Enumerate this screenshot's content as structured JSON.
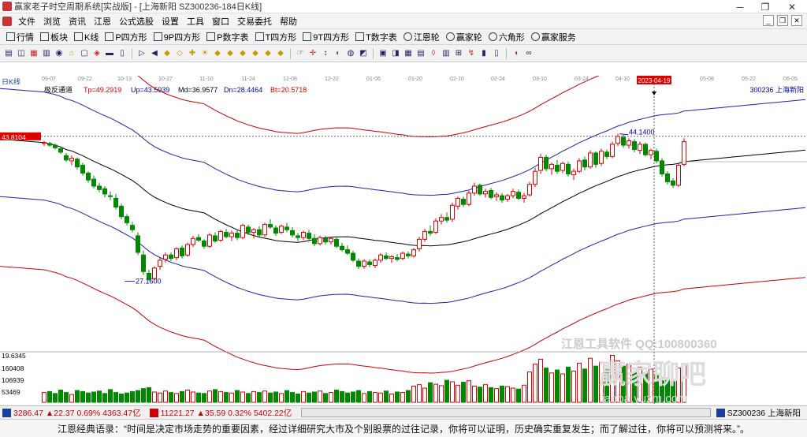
{
  "window": {
    "title": "赢家老子时空周期系统[实战版] - [上海新阳  SZ300236-184日K线]",
    "min": "─",
    "max": "❐",
    "close": "✕"
  },
  "menu": [
    "文件",
    "浏览",
    "资讯",
    "江恩",
    "公式选股",
    "设置",
    "工具",
    "窗口",
    "交易委托",
    "帮助"
  ],
  "toolbar1": [
    {
      "label": "行情",
      "icon": "grid-icon"
    },
    {
      "label": "板块",
      "icon": "blocks-icon"
    },
    {
      "label": "K线",
      "icon": "candle-icon"
    },
    {
      "label": "P四方形",
      "icon": "p-square-icon"
    },
    {
      "label": "9P四方形",
      "icon": "9p-square-icon"
    },
    {
      "label": "P数字表",
      "icon": "p-table-icon"
    },
    {
      "label": "T四方形",
      "icon": "t-square-icon"
    },
    {
      "label": "9T四方形",
      "icon": "9t-square-icon"
    },
    {
      "label": "T数字表",
      "icon": "t-table-icon"
    },
    {
      "label": "江恩轮",
      "icon": "gann-wheel-icon"
    },
    {
      "label": "赢家轮",
      "icon": "winner-wheel-icon"
    },
    {
      "label": "六角形",
      "icon": "hexagon-icon"
    },
    {
      "label": "赢家服务",
      "icon": "service-icon"
    }
  ],
  "toolbar2": [
    "▤",
    "◫",
    "▦",
    "▥",
    "◉",
    "⌂",
    "▢",
    "◈",
    "▬",
    "▯",
    "▷",
    "◀",
    "◆",
    "◇",
    "✚",
    "☀",
    "◆",
    "◆",
    "◆",
    "◆",
    "◆",
    "◆",
    "☞",
    "✛",
    "↕",
    "◐",
    "◍",
    "◩",
    "▣",
    "◨",
    "▦",
    "▤",
    "◊",
    "▥",
    "⊞",
    "↯",
    "▮",
    "▯",
    "◖",
    "∞"
  ],
  "dates": [
    "09-07",
    "09-22",
    "10-13",
    "10-27",
    "11-10",
    "11-24",
    "12-08",
    "12-22",
    "01-06",
    "01-20",
    "02-10",
    "02-24",
    "03-10",
    "03-24",
    "04-10",
    "2023-04-19",
    "05-08",
    "05-22",
    "06-05"
  ],
  "period": "日K线",
  "indicator": {
    "name": "极反通道",
    "tp": "Tp=49.2919",
    "up": "Up=43.5939",
    "md": "Md=36.9577",
    "dn": "Dn=28.4464",
    "bt": "Bt=20.5718"
  },
  "stock_tag": "300236 上海新阳",
  "price_marker": "43.8104",
  "annotations": {
    "high": "44.1400",
    "low": "27.1600"
  },
  "volume": {
    "max_label": "19.6345",
    "ticks": [
      "160408",
      "106939",
      "53469"
    ]
  },
  "watermark": {
    "line1": "江恩工具软件  QQ:100800360",
    "line2": "赢家聊吧",
    "line3": "liaoba.yuzm.com"
  },
  "status": [
    {
      "icon": "sh-index-icon",
      "text": "3286.47 ▲22.37 0.69% 4363.47亿",
      "color": "#c00"
    },
    {
      "icon": "sz-index-icon",
      "text": "11221.27 ▲35.59 0.32% 5402.22亿",
      "color": "#c00"
    },
    {
      "icon": "stock-icon",
      "text": "SZ300236 上海新阳",
      "color": "#000"
    }
  ],
  "quote": "江恩经典语录：“时间是决定市场走势的重要因素，经过详细研究大市及个别股票的过往记录，你将可以证明，历史确实重复发生；而了解过往，你将可以预测将来。”。",
  "chart_data": {
    "type": "candlestick",
    "title": "SZ300236 上海新阳 日K线",
    "ylim": [
      19.6345,
      49.5
    ],
    "candles": [
      [
        43.0,
        43.3,
        42.7,
        43.1
      ],
      [
        43.0,
        43.2,
        42.6,
        42.8
      ],
      [
        42.8,
        43.0,
        42.3,
        42.5
      ],
      [
        42.4,
        42.6,
        41.8,
        42.0
      ],
      [
        41.6,
        41.9,
        40.9,
        41.1
      ],
      [
        41.0,
        41.6,
        40.5,
        41.3
      ],
      [
        41.2,
        41.4,
        40.0,
        40.3
      ],
      [
        40.5,
        40.8,
        39.3,
        39.6
      ],
      [
        39.6,
        39.8,
        38.5,
        38.8
      ],
      [
        38.9,
        39.3,
        37.8,
        38.1
      ],
      [
        38.1,
        38.5,
        37.4,
        37.7
      ],
      [
        37.8,
        38.1,
        36.8,
        37.2
      ],
      [
        37.0,
        37.5,
        36.5,
        36.9
      ],
      [
        36.7,
        37.2,
        35.4,
        35.7
      ],
      [
        35.8,
        36.1,
        34.3,
        34.6
      ],
      [
        34.6,
        34.9,
        33.6,
        33.9
      ],
      [
        33.6,
        34.0,
        32.8,
        33.1
      ],
      [
        32.4,
        32.8,
        30.2,
        30.5
      ],
      [
        30.2,
        30.7,
        27.9,
        28.3
      ],
      [
        28.1,
        28.5,
        27.2,
        27.4
      ],
      [
        27.5,
        28.9,
        27.3,
        28.7
      ],
      [
        28.9,
        29.9,
        28.5,
        29.6
      ],
      [
        29.7,
        30.5,
        29.3,
        30.2
      ],
      [
        30.2,
        30.5,
        29.5,
        29.8
      ],
      [
        29.9,
        31.1,
        29.6,
        30.9
      ],
      [
        31.0,
        31.3,
        29.8,
        30.1
      ],
      [
        30.2,
        31.6,
        30.0,
        31.4
      ],
      [
        31.4,
        32.4,
        31.1,
        32.1
      ],
      [
        32.2,
        32.6,
        31.7,
        31.9
      ],
      [
        31.8,
        32.0,
        30.9,
        31.2
      ],
      [
        31.2,
        32.7,
        31.0,
        32.5
      ],
      [
        32.4,
        32.8,
        31.6,
        31.8
      ],
      [
        31.9,
        33.1,
        31.7,
        32.9
      ],
      [
        32.8,
        33.2,
        32.1,
        32.3
      ],
      [
        32.3,
        33.0,
        31.8,
        32.7
      ],
      [
        32.7,
        33.0,
        31.9,
        32.2
      ],
      [
        32.2,
        33.8,
        32.0,
        33.6
      ],
      [
        33.4,
        33.7,
        32.5,
        32.8
      ],
      [
        32.8,
        33.3,
        32.1,
        33.1
      ],
      [
        33.1,
        33.5,
        32.3,
        32.5
      ],
      [
        32.5,
        33.9,
        32.3,
        33.7
      ],
      [
        33.7,
        34.3,
        33.2,
        33.4
      ],
      [
        33.3,
        33.6,
        32.4,
        32.7
      ],
      [
        32.8,
        33.7,
        32.6,
        33.5
      ],
      [
        33.4,
        33.9,
        32.8,
        33.1
      ],
      [
        33.0,
        33.4,
        32.2,
        32.5
      ],
      [
        32.4,
        32.7,
        31.8,
        32.2
      ],
      [
        32.2,
        33.0,
        31.9,
        32.8
      ],
      [
        32.7,
        33.1,
        31.9,
        32.1
      ],
      [
        32.1,
        32.6,
        31.2,
        31.5
      ],
      [
        31.5,
        32.4,
        31.3,
        32.2
      ],
      [
        32.1,
        32.4,
        31.4,
        31.7
      ],
      [
        31.7,
        32.3,
        31.4,
        32.1
      ],
      [
        32.0,
        32.3,
        31.0,
        31.2
      ],
      [
        31.2,
        31.6,
        30.6,
        30.8
      ],
      [
        30.8,
        31.3,
        30.2,
        30.4
      ],
      [
        30.4,
        30.7,
        29.4,
        29.6
      ],
      [
        29.5,
        29.8,
        28.6,
        28.9
      ],
      [
        28.9,
        29.7,
        28.6,
        29.5
      ],
      [
        29.4,
        29.7,
        28.8,
        29.1
      ],
      [
        29.0,
        29.8,
        28.7,
        29.6
      ],
      [
        29.6,
        30.4,
        29.3,
        30.2
      ],
      [
        30.1,
        30.5,
        29.6,
        29.8
      ],
      [
        29.8,
        30.2,
        29.3,
        30.0
      ],
      [
        29.9,
        30.3,
        29.5,
        29.7
      ],
      [
        29.8,
        30.6,
        29.6,
        30.4
      ],
      [
        30.3,
        30.6,
        29.8,
        30.1
      ],
      [
        30.1,
        31.0,
        29.9,
        30.8
      ],
      [
        30.9,
        32.3,
        30.6,
        32.0
      ],
      [
        32.0,
        33.2,
        31.7,
        32.9
      ],
      [
        32.9,
        33.6,
        32.4,
        32.7
      ],
      [
        32.8,
        34.4,
        32.6,
        34.1
      ],
      [
        34.1,
        34.9,
        33.7,
        34.5
      ],
      [
        34.5,
        35.1,
        33.9,
        34.2
      ],
      [
        34.3,
        36.2,
        34.0,
        35.9
      ],
      [
        35.8,
        36.9,
        35.4,
        36.7
      ],
      [
        36.6,
        36.9,
        35.7,
        36.0
      ],
      [
        36.0,
        37.6,
        35.8,
        37.3
      ],
      [
        37.3,
        38.5,
        37.0,
        38.1
      ],
      [
        38.2,
        38.4,
        37.0,
        37.2
      ],
      [
        37.2,
        37.8,
        36.8,
        37.5
      ],
      [
        37.6,
        37.9,
        36.6,
        36.8
      ],
      [
        36.9,
        37.4,
        36.4,
        37.1
      ],
      [
        37.0,
        37.3,
        36.2,
        36.5
      ],
      [
        36.6,
        37.2,
        36.3,
        37.0
      ],
      [
        37.0,
        37.8,
        36.7,
        37.5
      ],
      [
        37.4,
        37.7,
        36.5,
        36.7
      ],
      [
        36.7,
        37.3,
        36.2,
        37.0
      ],
      [
        37.1,
        38.6,
        36.9,
        38.3
      ],
      [
        38.3,
        40.2,
        38.0,
        39.8
      ],
      [
        39.9,
        41.8,
        39.5,
        41.4
      ],
      [
        41.4,
        41.7,
        39.8,
        40.1
      ],
      [
        40.1,
        40.8,
        39.4,
        40.6
      ],
      [
        40.5,
        41.1,
        39.5,
        39.8
      ],
      [
        39.9,
        40.9,
        39.6,
        40.7
      ],
      [
        40.6,
        40.9,
        39.2,
        39.5
      ],
      [
        39.4,
        40.1,
        38.8,
        39.8
      ],
      [
        39.8,
        41.3,
        39.6,
        41.0
      ],
      [
        41.1,
        41.5,
        39.9,
        40.3
      ],
      [
        40.3,
        42.2,
        40.1,
        41.9
      ],
      [
        41.9,
        42.1,
        40.2,
        40.6
      ],
      [
        40.7,
        42.4,
        40.4,
        42.1
      ],
      [
        42.0,
        42.3,
        41.2,
        41.5
      ],
      [
        41.5,
        43.2,
        41.3,
        42.9
      ],
      [
        43.0,
        44.1,
        42.7,
        43.8
      ],
      [
        43.7,
        44.0,
        42.5,
        42.8
      ],
      [
        42.8,
        43.6,
        42.4,
        43.3
      ],
      [
        43.2,
        43.5,
        42.0,
        42.3
      ],
      [
        42.2,
        43.2,
        41.8,
        42.9
      ],
      [
        42.9,
        43.1,
        41.5,
        41.7
      ],
      [
        41.7,
        42.4,
        41.2,
        42.2
      ],
      [
        42.1,
        42.4,
        40.7,
        41.0
      ],
      [
        41.0,
        41.3,
        39.2,
        39.5
      ],
      [
        39.5,
        39.8,
        38.3,
        38.6
      ],
      [
        38.7,
        39.0,
        37.9,
        38.2
      ],
      [
        38.2,
        40.8,
        38.0,
        40.5
      ],
      [
        40.6,
        43.6,
        40.4,
        43.2
      ]
    ],
    "volume": [
      20,
      22,
      18,
      25,
      20,
      16,
      24,
      22,
      19,
      21,
      23,
      18,
      26,
      20,
      17,
      19,
      22,
      24,
      28,
      30,
      21,
      19,
      23,
      20,
      18,
      22,
      25,
      21,
      19,
      18,
      23,
      26,
      22,
      20,
      19,
      24,
      21,
      18,
      22,
      20,
      23,
      19,
      21,
      18,
      24,
      20,
      17,
      22,
      19,
      21,
      23,
      18,
      20,
      25,
      22,
      19,
      21,
      24,
      18,
      22,
      20,
      19,
      23,
      17,
      21,
      20,
      24,
      33,
      36,
      29,
      40,
      37,
      34,
      45,
      42,
      35,
      41,
      44,
      33,
      31,
      36,
      30,
      28,
      33,
      32,
      29,
      27,
      35,
      62,
      78,
      88,
      70,
      60,
      66,
      58,
      72,
      64,
      80,
      68,
      90,
      74,
      82,
      70,
      96,
      85,
      74,
      78,
      62,
      72,
      60,
      68,
      55,
      50,
      45,
      42,
      70,
      78
    ]
  }
}
